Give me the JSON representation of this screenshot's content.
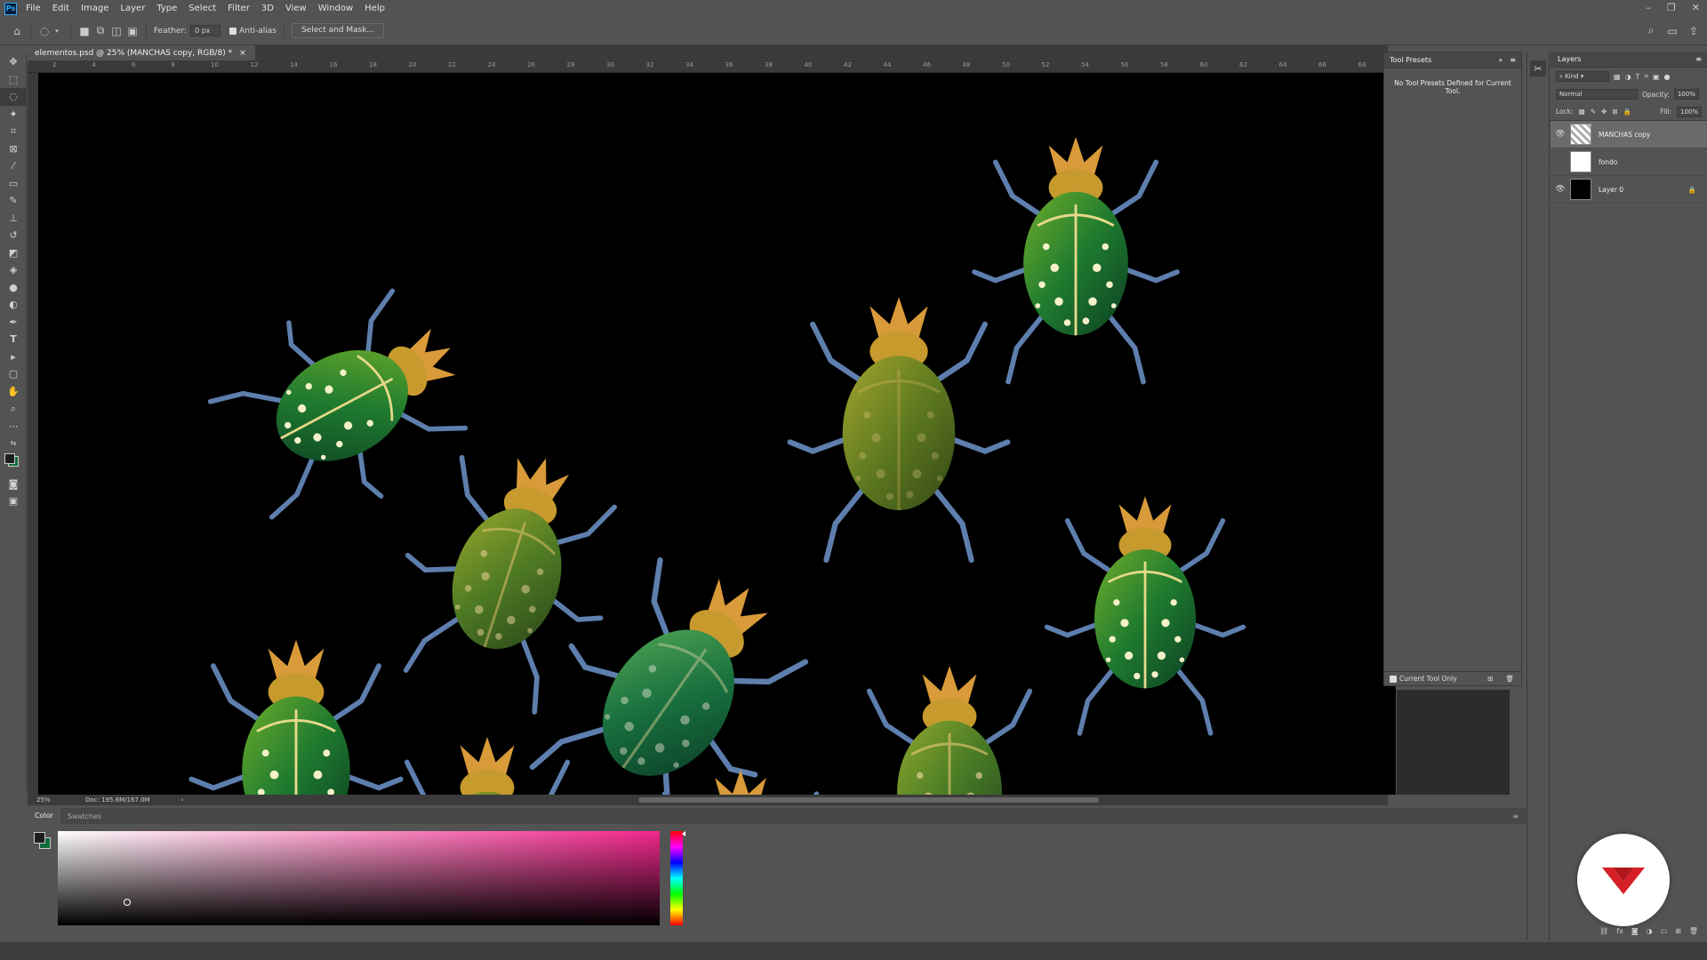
{
  "app": {
    "logo": "Ps",
    "menus": [
      "File",
      "Edit",
      "Image",
      "Layer",
      "Type",
      "Select",
      "Filter",
      "3D",
      "View",
      "Window",
      "Help"
    ],
    "window_controls": [
      "–",
      "❐",
      "✕"
    ]
  },
  "options_bar": {
    "feather_label": "Feather:",
    "feather_value": "0 px",
    "antialias_label": "Anti-alias",
    "select_mask_label": "Select and Mask..."
  },
  "document": {
    "tab_title": "elementos.psd @ 25% (MANCHAS copy, RGB/8) *",
    "close": "×",
    "zoom": "25%",
    "doc_info": "Doc: 195.6M/167.0M",
    "ruler_labels": [
      "2",
      "4",
      "6",
      "8",
      "10",
      "12",
      "14",
      "16",
      "18",
      "20",
      "22",
      "24",
      "26",
      "28",
      "30",
      "32",
      "34",
      "36",
      "38",
      "40",
      "42",
      "44",
      "46",
      "48",
      "50",
      "52",
      "54",
      "56",
      "58",
      "60",
      "62",
      "64",
      "66",
      "68"
    ]
  },
  "tool_presets": {
    "title": "Tool Presets",
    "message": "No Tool Presets Defined for Current Tool.",
    "current_tool_only": "Current Tool Only"
  },
  "layers_panel": {
    "title": "Layers",
    "filter_kind": "Kind",
    "blend_mode": "Normal",
    "opacity_label": "Opacity:",
    "opacity_value": "100%",
    "lock_label": "Lock:",
    "fill_label": "Fill:",
    "fill_value": "100%",
    "layers": [
      {
        "name": "MANCHAS copy",
        "visible": true,
        "selected": true
      },
      {
        "name": "fondo",
        "visible": false,
        "selected": false
      },
      {
        "name": "Layer 0",
        "visible": true,
        "selected": false,
        "locked": true
      }
    ]
  },
  "color_panel": {
    "tabs": [
      "Color",
      "Swatches"
    ],
    "hue_color": "#f2278c"
  }
}
